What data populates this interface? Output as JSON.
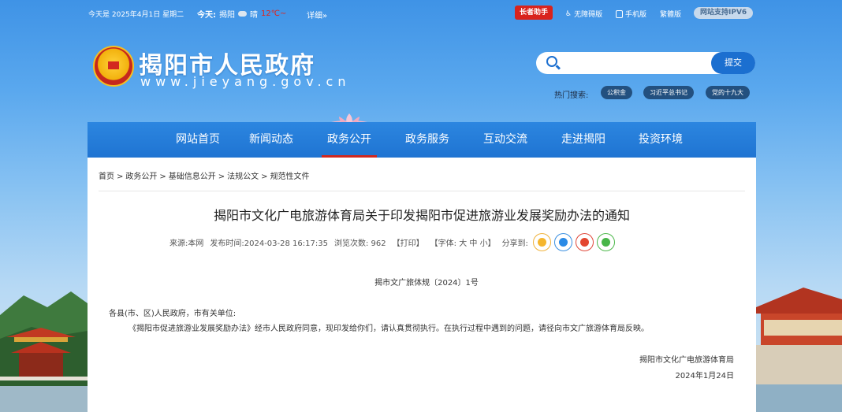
{
  "topbar": {
    "date": "今天是 2025年4月1日 星期二",
    "weather_label": "今天:",
    "city": "揭阳",
    "condition": "晴",
    "temp": "12℃~",
    "detail": "详细»",
    "elder_mode": "长者助手",
    "accessible": "无障碍版",
    "mobile": "手机版",
    "traditional": "繁體版",
    "ipv6": "网站支持IPV6"
  },
  "header": {
    "title": "揭阳市人民政府",
    "url": "www.jieyang.gov.cn",
    "emblem_icon": "national-emblem-icon"
  },
  "search": {
    "placeholder": "",
    "submit": "提交",
    "hot_label": "热门搜索:",
    "hot_tags": [
      "公积金",
      "习近平总书记",
      "党的十九大"
    ]
  },
  "nav": {
    "items": [
      "网站首页",
      "新闻动态",
      "政务公开",
      "政务服务",
      "互动交流",
      "走进揭阳",
      "投资环境"
    ],
    "active": "政务公开"
  },
  "breadcrumb": [
    "首页",
    "政务公开",
    "基础信息公开",
    "法规公文",
    "规范性文件"
  ],
  "article": {
    "title": "揭阳市文化广电旅游体育局关于印发揭阳市促进旅游业发展奖励办法的通知",
    "source_label": "来源:",
    "source": "本网",
    "time_label": "发布时间:",
    "time": "2024-03-28 16:17:35",
    "views_label": "浏览次数:",
    "views": "962",
    "print": "【打印】",
    "font_label": "【字体:",
    "font_large": "大",
    "font_medium": "中",
    "font_small": "小】",
    "share_label": "分享到:",
    "share_icons": [
      "qzone-icon",
      "qq-icon",
      "weibo-icon",
      "wechat-icon"
    ],
    "doc_number": "揭市文广旅体规〔2024〕1号",
    "addressee": "各县(市、区)人民政府，市有关单位:",
    "body": "《揭阳市促进旅游业发展奖励办法》经市人民政府同意，现印发给你们，请认真贯彻执行。在执行过程中遇到的问题，请径向市文广旅游体育局反映。",
    "sign_org": "揭阳市文化广电旅游体育局",
    "sign_date": "2024年1月24日"
  },
  "colors": {
    "nav_blue": "#1f74d2",
    "active_underline": "#d0271e",
    "elder_red": "#d9231d"
  }
}
